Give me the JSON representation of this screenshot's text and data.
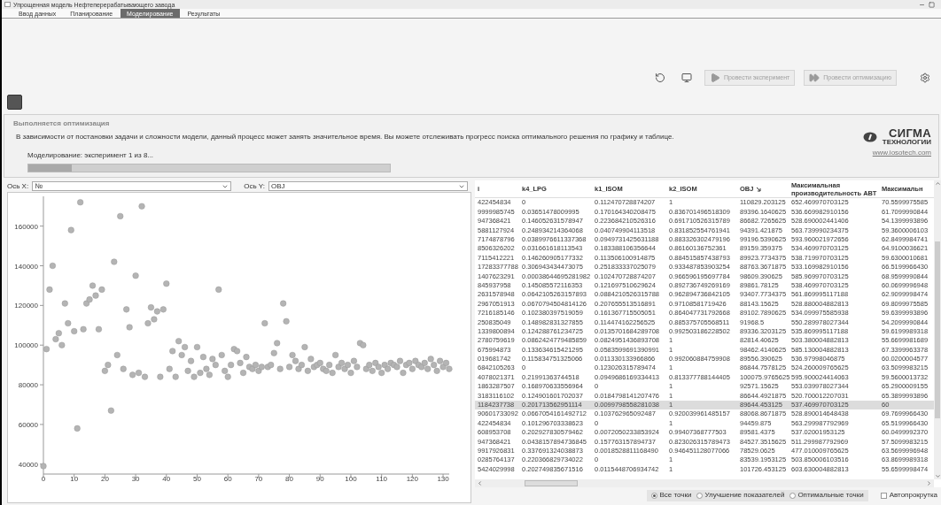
{
  "window": {
    "title": "Упрощенная модель Нефтеперерабатывающего завода"
  },
  "tabs": [
    {
      "label": "Ввод данных",
      "selected": false
    },
    {
      "label": "Планирование",
      "selected": false
    },
    {
      "label": "Моделирование",
      "selected": true
    },
    {
      "label": "Результаты",
      "selected": false
    }
  ],
  "toolbar": {
    "buttons": [
      {
        "kind": "icon"
      },
      {
        "kind": "icon"
      },
      {
        "kind": "text",
        "label": "Провести эксперимент",
        "disabled": true
      },
      {
        "kind": "text",
        "label": "Провести оптимизацию",
        "disabled": true
      },
      {
        "kind": "icon"
      }
    ]
  },
  "status_panel": {
    "title": "Выполняется оптимизация",
    "message": "В зависимости от постановки задачи и сложности модели, данный процесс может занять значительное время. Вы можете отслеживать прогресс поиска оптимального решения по графику и таблице.",
    "progress_label": "Моделирование: эксперимент 1 из 8...",
    "level": 0.12,
    "logo": {
      "name": "СИГМА",
      "subtitle": "ТЕХНОЛОГИИ",
      "link": "www.iosotech.com"
    }
  },
  "axis_x": {
    "label": "Ось X:",
    "value": "№"
  },
  "axis_y": {
    "label": "Ось Y:",
    "value": "OBJ"
  },
  "chart_data": {
    "type": "scatter",
    "xlim": [
      0,
      132
    ],
    "ylim": [
      35000,
      175000
    ],
    "xticks": [
      0,
      10,
      20,
      30,
      40,
      50,
      60,
      70,
      80,
      90,
      100,
      110,
      120,
      130
    ],
    "yticks": [
      40000,
      60000,
      80000,
      100000,
      120000,
      140000,
      160000
    ],
    "x": [
      0,
      1,
      2,
      3,
      4,
      5,
      6,
      7,
      8,
      9,
      10,
      11,
      12,
      13,
      14,
      15,
      16,
      17,
      18,
      19,
      20,
      21,
      22,
      23,
      24,
      25,
      26,
      27,
      28,
      29,
      30,
      31,
      32,
      33,
      34,
      35,
      36,
      37,
      38,
      39,
      40,
      41,
      42,
      43,
      44,
      45,
      46,
      47,
      48,
      49,
      50,
      51,
      52,
      53,
      54,
      55,
      56,
      57,
      58,
      59,
      60,
      61,
      62,
      63,
      64,
      65,
      66,
      67,
      68,
      69,
      70,
      71,
      72,
      73,
      74,
      75,
      76,
      77,
      78,
      79,
      80,
      81,
      82,
      83,
      84,
      85,
      86,
      87,
      88,
      89,
      90,
      91,
      92,
      93,
      94,
      95,
      96,
      97,
      98,
      99,
      100,
      101,
      102,
      103,
      104,
      105,
      106,
      107,
      108,
      109,
      110,
      111,
      112,
      113,
      114,
      115,
      116,
      117,
      118,
      119,
      120,
      121,
      122,
      123,
      124,
      125,
      126,
      127,
      128,
      129,
      130,
      131,
      132
    ],
    "series": [
      {
        "color": "#b4b4b4",
        "values": [
          39000,
          98000,
          128000,
          140000,
          103000,
          106000,
          100000,
          121000,
          111000,
          158000,
          107000,
          58000,
          172000,
          108000,
          121000,
          123000,
          130000,
          125000,
          108000,
          128000,
          87000,
          90000,
          67000,
          142000,
          95000,
          165000,
          88000,
          118000,
          109000,
          85000,
          135000,
          86000,
          170000,
          84000,
          111000,
          119000,
          113000,
          117000,
          84000,
          118000,
          131000,
          88000,
          97000,
          84000,
          102000,
          95000,
          99000,
          87000,
          92000,
          84000,
          99000,
          86000,
          94000,
          88000,
          85000,
          93000,
          90000,
          128000,
          95000,
          87000,
          84000,
          90000,
          98000,
          97000,
          91000,
          86000,
          94000,
          89000,
          88000,
          90000,
          87000,
          89000,
          111000,
          89000,
          90000,
          96000,
          101000,
          88000,
          121000,
          112000,
          89000,
          95000,
          92000,
          88000,
          90000,
          99000,
          87000,
          93000,
          89000,
          90000,
          91000,
          88000,
          87000,
          90000,
          86000,
          95000,
          89000,
          91000,
          88000,
          90000,
          86000,
          92000,
          89000,
          101000,
          100000,
          88000,
          90000,
          87000,
          91000,
          89000,
          86000,
          90000,
          88000,
          91000,
          90000,
          89000,
          92000,
          86000,
          90000,
          91000,
          88000,
          92000,
          90000,
          89000,
          91000,
          88000,
          93000,
          90000,
          87000,
          92000,
          89000,
          91000,
          88000
        ]
      }
    ]
  },
  "table": {
    "columns": [
      {
        "label": "i",
        "sorted": false
      },
      {
        "label": "k4_LPG",
        "sorted": false
      },
      {
        "label": "k1_ISOM",
        "sorted": false
      },
      {
        "label": "k2_ISOM",
        "sorted": false
      },
      {
        "label": "OBJ",
        "sorted": true
      },
      {
        "label": "Максимальная производительность АВТ",
        "sorted": false
      },
      {
        "label": "Максимальн",
        "sorted": false
      }
    ],
    "rows": [
      {
        "selected": false,
        "cells": [
          "422454834",
          "0",
          "0.112470728874207",
          "1",
          "110829.203125",
          "652.469970703125",
          "70.5599975585"
        ]
      },
      {
        "selected": false,
        "cells": [
          "9999985745",
          "0.03651478009995",
          "0.170164340208475",
          "0.836701496518309",
          "89396.1640625",
          "536.669982910156",
          "61.7099990844"
        ]
      },
      {
        "selected": false,
        "cells": [
          "947368421",
          "0.146052631578947",
          "0.223684210526316",
          "0.691710526315789",
          "86682.7265625",
          "528.690002441406",
          "54.1399993896"
        ]
      },
      {
        "selected": false,
        "cells": [
          "5881127924",
          "0.248934214364068",
          "0.040749904113518",
          "0.831852554761941",
          "94391.421875",
          "563.739990234375",
          "59.3600006103"
        ]
      },
      {
        "selected": false,
        "cells": [
          "7174878796",
          "0.0389976611337368",
          "0.0949731425631188",
          "0.883326302479196",
          "99196.5390625",
          "593.960021972656",
          "62.8499984741"
        ]
      },
      {
        "selected": false,
        "cells": [
          "8506326202",
          "0.031661618113543",
          "0.183388106356644",
          "0.86160136752361",
          "89159.359375",
          "534.469970703125",
          "64.9100036621"
        ]
      },
      {
        "selected": false,
        "cells": [
          "7115412221",
          "0.146260905177332",
          "0.113506100914875",
          "0.884515857438793",
          "89923.7734375",
          "538.719970703125",
          "59.6300010681"
        ]
      },
      {
        "selected": false,
        "cells": [
          "17283377788",
          "0.306943434473075",
          "0.251833337025079",
          "0.933487853903254",
          "88763.3671875",
          "533.169982910156",
          "66.5199966430"
        ]
      },
      {
        "selected": false,
        "cells": [
          "1407623291",
          "0.00038644695281982",
          "0.102470728874207",
          "0.966596195697784",
          "98609.390625",
          "585.969970703125",
          "68.9599990844"
        ]
      },
      {
        "selected": false,
        "cells": [
          "845937958",
          "0.145085572116353",
          "0.121697510629624",
          "0.892736749269169",
          "89861.78125",
          "538.469970703125",
          "60.0699996948"
        ]
      },
      {
        "selected": false,
        "cells": [
          "2631578948",
          "0.0642105263157893",
          "0.0884210526315788",
          "0.962894736842105",
          "93407.7734375",
          "561.869995117188",
          "62.9099998474"
        ]
      },
      {
        "selected": false,
        "cells": [
          "2967051913",
          "0.0670794504814126",
          "0.207655513516891",
          "0.97108581719426",
          "88143.15625",
          "528.880004882813",
          "69.8099975585"
        ]
      },
      {
        "selected": false,
        "cells": [
          "7216185146",
          "0.102380397519059",
          "0.161367715505051",
          "0.864047731792668",
          "89102.7890625",
          "534.099975585938",
          "59.6399993896"
        ]
      },
      {
        "selected": false,
        "cells": [
          "250835049",
          "0.148982831327855",
          "0.114474162256525",
          "0.885375705568511",
          "91968.5",
          "550.289978027344",
          "54.2099990844"
        ]
      },
      {
        "selected": false,
        "cells": [
          "1339800894",
          "0.124288761234725",
          "0.0135701684289708",
          "0.992503186228502",
          "89336.3203125",
          "535.869995117188",
          "59.6199989318"
        ]
      },
      {
        "selected": false,
        "cells": [
          "2780759619",
          "0.0862424779485859",
          "0.0824951436893708",
          "1",
          "82814.40625",
          "503.380004882813",
          "55.6699981689"
        ]
      },
      {
        "selected": false,
        "cells": [
          "675994873",
          "0.133634615421295",
          "0.0583599691390991",
          "1",
          "98462.4140625",
          "585.130004882813",
          "67.3399963378"
        ]
      },
      {
        "selected": false,
        "cells": [
          "019681742",
          "0.115834751325066",
          "0.011330133966866",
          "0.992060884759908",
          "89556.390625",
          "536.97998046875",
          "60.0200004577"
        ]
      },
      {
        "selected": false,
        "cells": [
          "6842105263",
          "0",
          "0.123026315789474",
          "1",
          "86844.7578125",
          "524.260009765625",
          "63.5099983215"
        ]
      },
      {
        "selected": false,
        "cells": [
          "4078021371",
          "0.21991363744518",
          "0.0949686169334413",
          "0.813377788144405",
          "100075.9765625",
          "595.900024414063",
          "59.5600013732"
        ]
      },
      {
        "selected": false,
        "cells": [
          "1863287507",
          "0.168970633556964",
          "0",
          "1",
          "92571.15625",
          "553.039978027344",
          "65.2900009155"
        ]
      },
      {
        "selected": false,
        "cells": [
          "3183116102",
          "0.124901601702037",
          "0.0184798141207476",
          "1",
          "86644.4921875",
          "520.700012207031",
          "65.3899993896"
        ]
      },
      {
        "selected": true,
        "cells": [
          "1184237738",
          "0.201713562951114",
          "0.0099798558281038",
          "1",
          "89644.453125",
          "537.469970703125",
          "60"
        ]
      },
      {
        "selected": false,
        "cells": [
          "90601733092",
          "0.0667054161492712",
          "0.103762965092487",
          "0.920039961485157",
          "88068.8671875",
          "528.890014648438",
          "69.7699966430"
        ]
      },
      {
        "selected": false,
        "cells": [
          "422454834",
          "0.101296703338623",
          "0",
          "1",
          "94459.875",
          "563.299987792969",
          "65.5199966430"
        ]
      },
      {
        "selected": false,
        "cells": [
          "608953708",
          "0.202927830579462",
          "0.0072050233853924",
          "0.99407368777503",
          "89581.4375",
          "537.02001953125",
          "60.0499992370"
        ]
      },
      {
        "selected": false,
        "cells": [
          "947368421",
          "0.0438157894736845",
          "0.157763157894737",
          "0.823026315789473",
          "84527.3515625",
          "511.299987792969",
          "57.5099983215"
        ]
      },
      {
        "selected": false,
        "cells": [
          "9917926831",
          "0.337691324038873",
          "0.0018528811168490",
          "0.946451128077066",
          "78529.0625",
          "477.010009765625",
          "63.5699996948"
        ]
      },
      {
        "selected": false,
        "cells": [
          "0285764137",
          "0.220366829734022",
          "0",
          "1",
          "83539.1953125",
          "503.850006103516",
          "63.8699989318"
        ]
      },
      {
        "selected": false,
        "cells": [
          "5424029998",
          "0.202749835671516",
          "0.0115448706934742",
          "1",
          "101726.453125",
          "603.630004882813",
          "55.6599998474"
        ]
      }
    ]
  },
  "filters": [
    {
      "label": "Все точки",
      "selected": true
    },
    {
      "label": "Улучшение показателей",
      "selected": false
    },
    {
      "label": "Оптимальные точки",
      "selected": false
    }
  ],
  "autoscroll": {
    "label": "Автопрокрутка",
    "checked": false
  }
}
